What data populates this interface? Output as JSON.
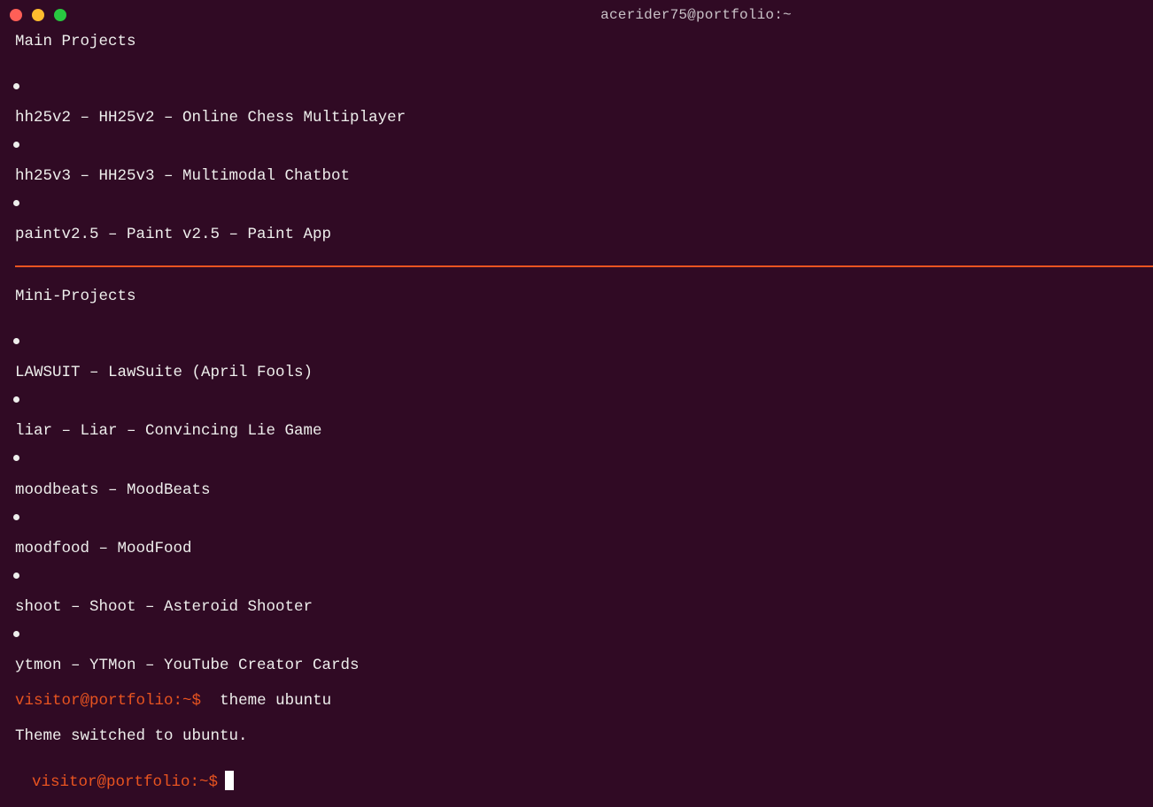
{
  "window": {
    "title": "acerider75@portfolio:~",
    "controls": [
      "close",
      "minimize",
      "maximize"
    ]
  },
  "main_section": {
    "heading": "Main Projects",
    "items": [
      "hh25v2 – HH25v2 – Online Chess Multiplayer",
      "hh25v3 – HH25v3 – Multimodal Chatbot",
      "paintv2.5 – Paint v2.5 – Paint App"
    ]
  },
  "mini_section": {
    "heading": "Mini-Projects",
    "items": [
      "LAWSUIT – LawSuite (April Fools)",
      "liar – Liar – Convincing Lie Game",
      "moodbeats – MoodBeats",
      "moodfood – MoodFood",
      "shoot – Shoot – Asteroid Shooter",
      "ytmon – YTMon – YouTube Creator Cards"
    ]
  },
  "history": {
    "prompt": "visitor@portfolio:~$",
    "command": "theme ubuntu",
    "output": "Theme switched to ubuntu."
  },
  "active_prompt": {
    "prompt": "visitor@portfolio:~$",
    "input": ""
  },
  "colors": {
    "background": "#300a24",
    "text": "#eeeeec",
    "accent": "#e95420"
  }
}
